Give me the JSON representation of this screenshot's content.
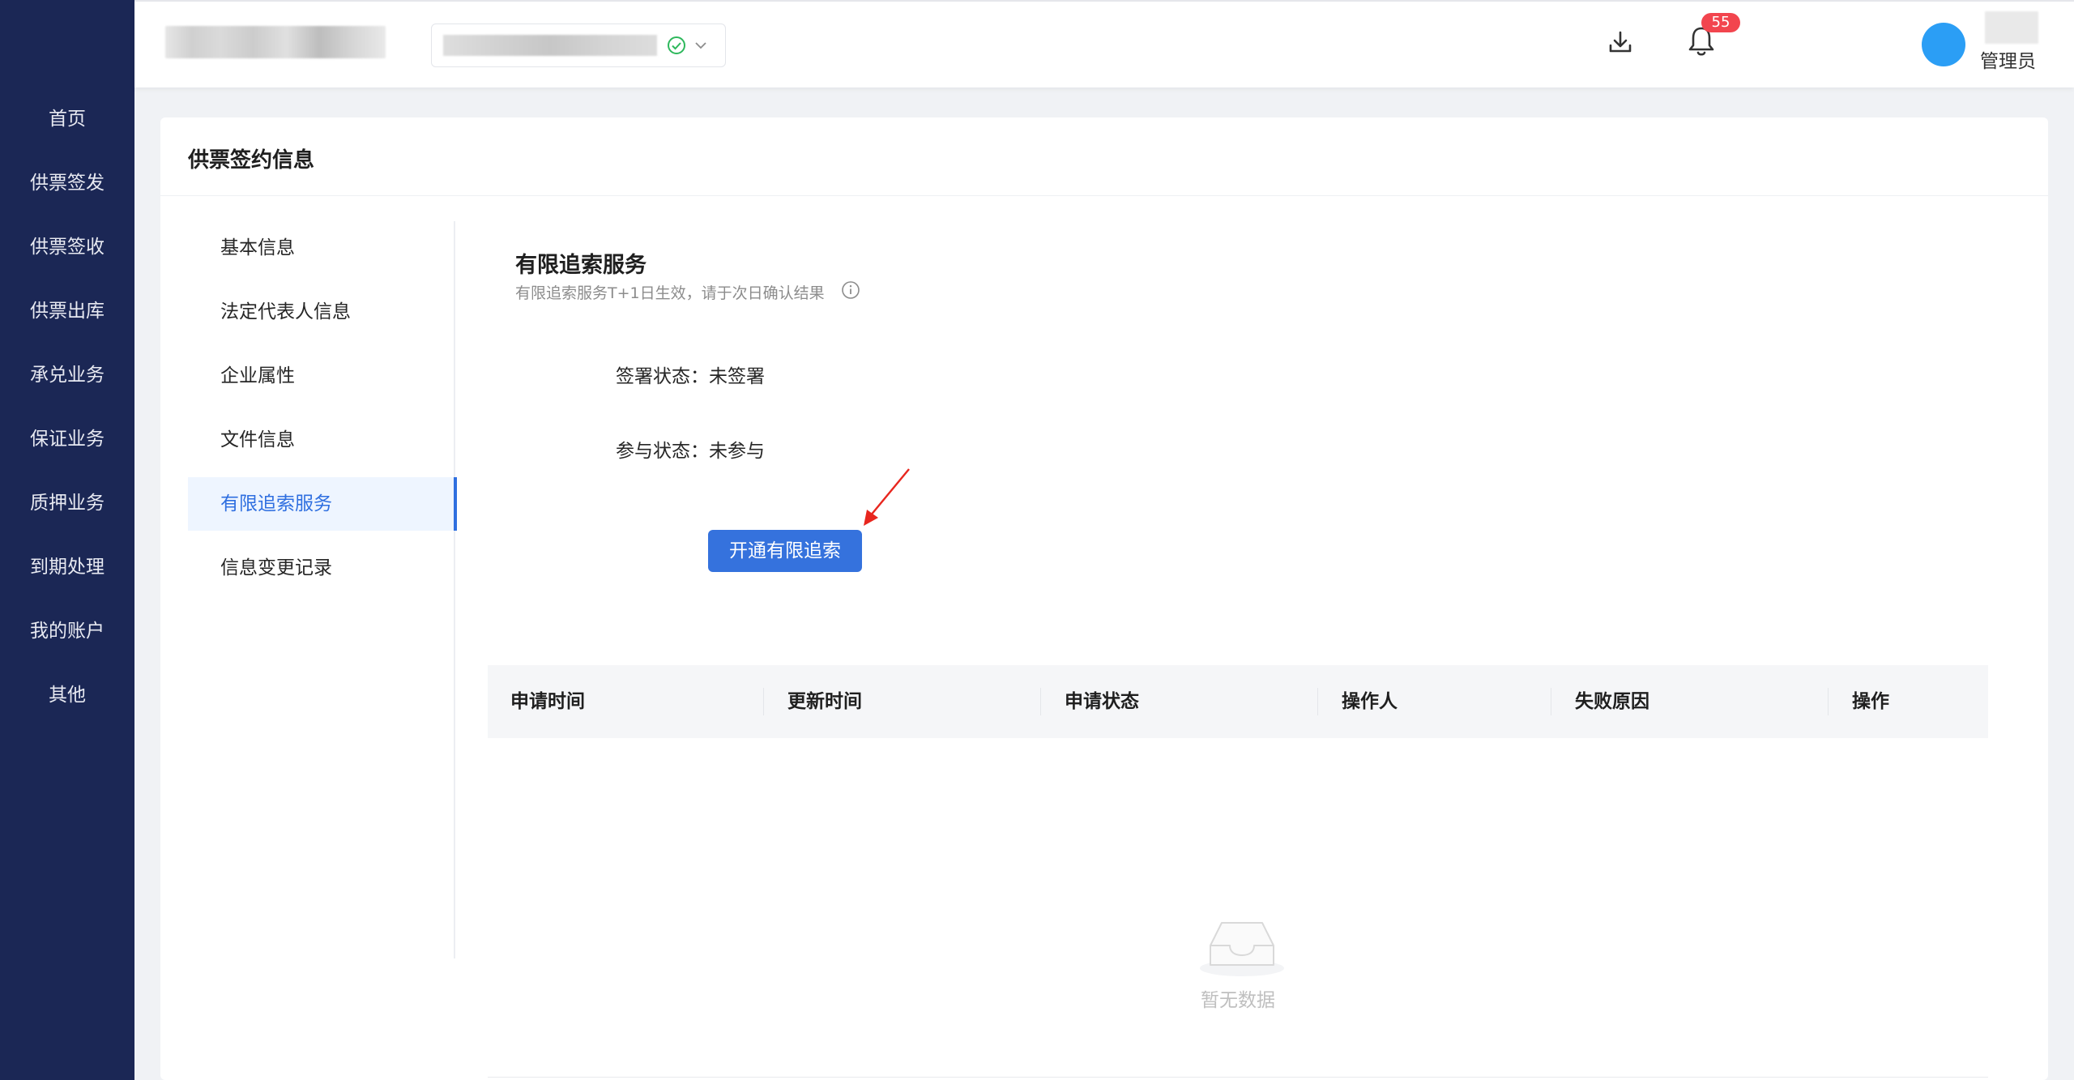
{
  "sidebar": {
    "items": [
      {
        "label": "首页"
      },
      {
        "label": "供票签发"
      },
      {
        "label": "供票签收"
      },
      {
        "label": "供票出库"
      },
      {
        "label": "承兑业务"
      },
      {
        "label": "保证业务"
      },
      {
        "label": "质押业务"
      },
      {
        "label": "到期处理"
      },
      {
        "label": "我的账户"
      },
      {
        "label": "其他"
      }
    ]
  },
  "header": {
    "notification_count": "55",
    "user_role": "管理员",
    "icons": [
      "download-icon",
      "bell-icon",
      "check-circle-icon",
      "chevron-down-icon"
    ]
  },
  "card": {
    "title": "供票签约信息"
  },
  "sub_nav": {
    "items": [
      {
        "label": "基本信息"
      },
      {
        "label": "法定代表人信息"
      },
      {
        "label": "企业属性"
      },
      {
        "label": "文件信息"
      },
      {
        "label": "有限追索服务",
        "active": true
      },
      {
        "label": "信息变更记录"
      }
    ]
  },
  "section": {
    "title": "有限追索服务",
    "hint": "有限追索服务T+1日生效，请于次日确认结果",
    "sign_status": "签署状态：未签署",
    "join_status": "参与状态：未参与",
    "open_button": "开通有限追索"
  },
  "table": {
    "columns": [
      "申请时间",
      "更新时间",
      "申请状态",
      "操作人",
      "失败原因",
      "操作"
    ],
    "rows": [],
    "empty_text": "暂无数据"
  },
  "colors": {
    "sidebar_bg": "#1b2755",
    "primary": "#3572dd",
    "active_bg": "#eef5ff",
    "badge": "#f2454e",
    "avatar": "#2b9ef5",
    "annotation_arrow": "#e8261e"
  }
}
